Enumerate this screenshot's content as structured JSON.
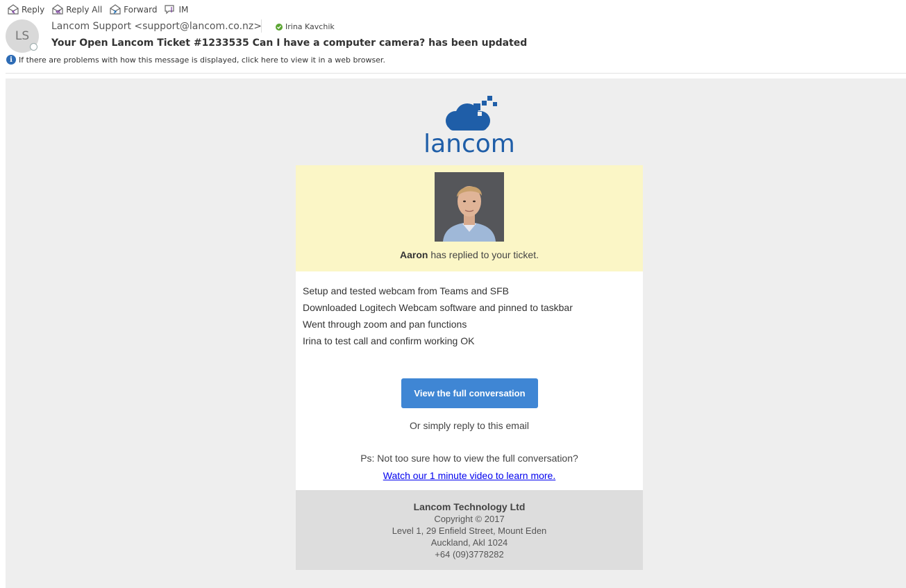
{
  "toolbar": {
    "reply": "Reply",
    "reply_all": "Reply All",
    "forward": "Forward",
    "im": "IM"
  },
  "header": {
    "avatar_initials": "LS",
    "from": "Lancom Support <support@lancom.co.nz>",
    "to": "Irina Kavchik",
    "subject": "Your Open Lancom Ticket #1233535 Can I have a computer camera? has been updated",
    "info": "If there are problems with how this message is displayed, click here to view it in a web browser."
  },
  "email": {
    "logo_text": "lancom",
    "replier": "Aaron",
    "replied_text": " has replied to your ticket.",
    "notes": [
      "Setup and tested webcam from Teams and SFB",
      "Downloaded Logitech Webcam software and pinned to taskbar",
      "Went through zoom and pan functions",
      "Irina to test call and confirm working OK"
    ],
    "cta_label": "View the full conversation",
    "or_reply": "Or simply reply to this email",
    "ps": "Ps: Not too sure how to view the full conversation?",
    "video_link": "Watch our 1 minute video to learn more.",
    "footer": {
      "company": "Lancom Technology Ltd",
      "copyright": "Copyright © 2017",
      "address1": "Level 1, 29 Enfield Street, Mount Eden",
      "address2": "Auckland, Akl 1024",
      "phone": "+64 (09)3778282"
    }
  },
  "colors": {
    "brand_blue": "#1f5ea8",
    "button_blue": "#3f86d4",
    "highlight_yellow": "#fbf6c6",
    "presence_green": "#5ba532"
  }
}
